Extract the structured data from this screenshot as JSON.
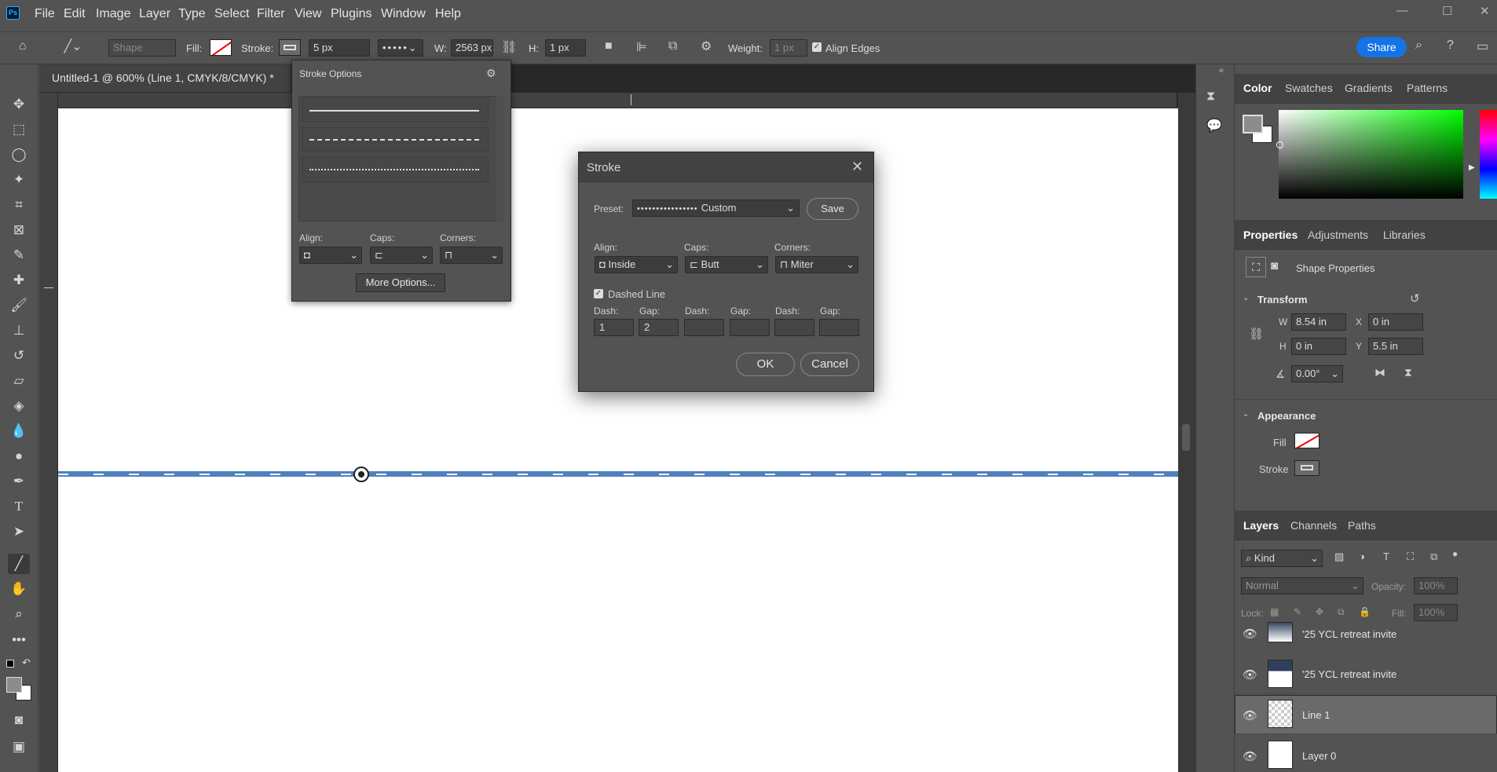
{
  "app": {
    "logo": "Ps"
  },
  "menu": [
    "File",
    "Edit",
    "Image",
    "Layer",
    "Type",
    "Select",
    "Filter",
    "View",
    "Plugins",
    "Window",
    "Help"
  ],
  "options": {
    "shape_mode": "Shape",
    "fill_label": "Fill:",
    "stroke_label": "Stroke:",
    "stroke_width": "5 px",
    "w_label": "W:",
    "w_value": "2563 px",
    "h_label": "H:",
    "h_value": "1 px",
    "weight_label": "Weight:",
    "weight_value": "1 px",
    "align_edges": "Align Edges",
    "share": "Share"
  },
  "document": {
    "tab_title": "Untitled-1 @ 600% (Line 1, CMYK/8/CMYK) *"
  },
  "stroke_options": {
    "title": "Stroke Options",
    "align_label": "Align:",
    "caps_label": "Caps:",
    "corners_label": "Corners:",
    "more_options": "More Options..."
  },
  "stroke_dialog": {
    "title": "Stroke",
    "preset_label": "Preset:",
    "preset_value": "Custom",
    "save": "Save",
    "align_label": "Align:",
    "align_value": "Inside",
    "caps_label": "Caps:",
    "caps_value": "Butt",
    "corners_label": "Corners:",
    "corners_value": "Miter",
    "dashed_line": "Dashed Line",
    "dash_label": "Dash:",
    "gap_label": "Gap:",
    "dash1": "1",
    "gap1": "2",
    "ok": "OK",
    "cancel": "Cancel"
  },
  "color_panel": {
    "tabs": [
      "Color",
      "Swatches",
      "Gradients",
      "Patterns"
    ]
  },
  "properties_panel": {
    "tabs": [
      "Properties",
      "Adjustments",
      "Libraries"
    ],
    "subtitle": "Shape Properties",
    "transform": "Transform",
    "w_label": "W",
    "w_value": "8.54 in",
    "x_label": "X",
    "x_value": "0 in",
    "h_label": "H",
    "h_value": "0 in",
    "y_label": "Y",
    "y_value": "5.5 in",
    "angle": "0.00°",
    "appearance": "Appearance",
    "fill_label": "Fill",
    "stroke_label": "Stroke"
  },
  "layers_panel": {
    "tabs": [
      "Layers",
      "Channels",
      "Paths"
    ],
    "kind": "Kind",
    "blend": "Normal",
    "opacity_label": "Opacity:",
    "opacity_value": "100%",
    "lock_label": "Lock:",
    "fill_label": "Fill:",
    "fill_value": "100%",
    "layers": [
      {
        "name": "'25 YCL retreat invite"
      },
      {
        "name": "'25 YCL retreat invite"
      },
      {
        "name": "Line 1"
      },
      {
        "name": "Layer 0"
      }
    ]
  },
  "colors": {
    "accent": "#1473e6",
    "line": "#4f81bd"
  }
}
